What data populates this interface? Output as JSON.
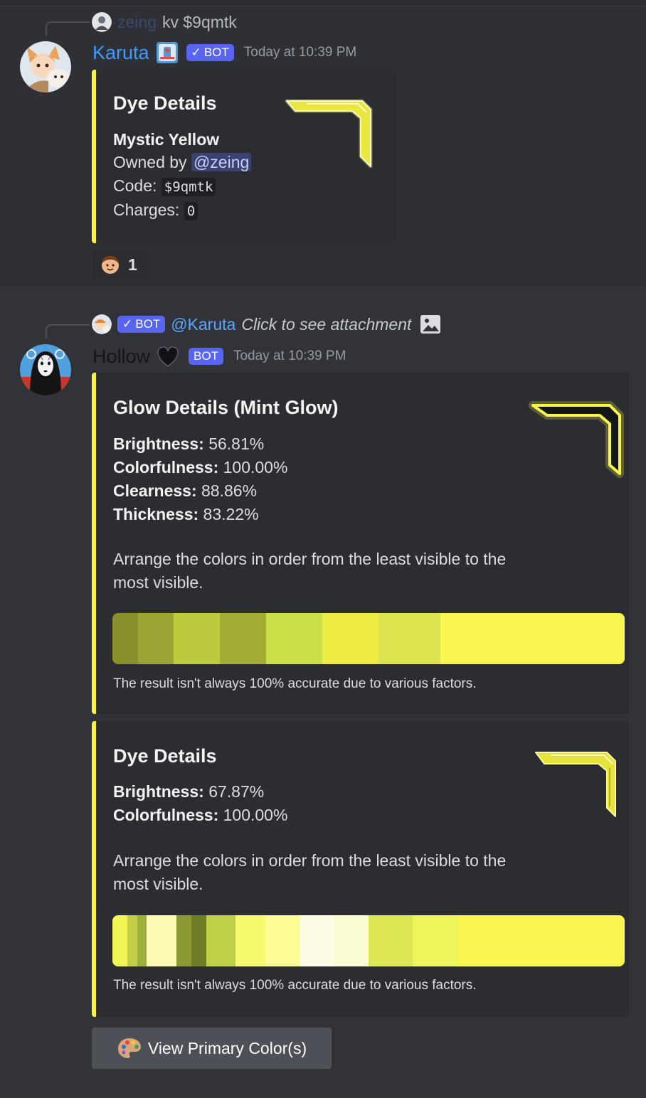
{
  "message1": {
    "reply": {
      "username": "zeing",
      "command": "kv $9qmtk"
    },
    "author": "Karuta",
    "bot_tag": "BOT",
    "timestamp": "Today at 10:39 PM",
    "embed": {
      "title": "Dye Details",
      "dye_name": "Mystic Yellow",
      "owned_label": "Owned by",
      "owner": "@zeing",
      "code_label": "Code:",
      "code": "$9qmtk",
      "charges_label": "Charges:",
      "charges": "0"
    },
    "reaction": {
      "count": "1",
      "emoji": "person-emoji"
    }
  },
  "message2": {
    "reply": {
      "bot_tag": "BOT",
      "mention": "@Karuta",
      "text": "Click to see attachment",
      "icon": "image-icon"
    },
    "author": "Hollow",
    "bot_tag": "BOT",
    "timestamp": "Today at 10:39 PM",
    "embed1": {
      "title": "Glow Details (Mint Glow)",
      "stats": [
        {
          "label": "Brightness:",
          "value": "56.81%"
        },
        {
          "label": "Colorfulness:",
          "value": "100.00%"
        },
        {
          "label": "Clearness:",
          "value": "88.86%"
        },
        {
          "label": "Thickness:",
          "value": "83.22%"
        }
      ],
      "instruction": "Arrange the colors in order from the least visible to the most visible.",
      "footer": "The result isn't always 100% accurate due to various factors.",
      "swatches": [
        "#8a902c",
        "#9da634",
        "#bccb3d",
        "#a3ad33",
        "#cadf48",
        "#eeec43",
        "#dde34c",
        "#f9f74f"
      ],
      "swatch_weights": [
        5,
        7,
        9,
        9,
        11,
        11,
        12,
        36
      ]
    },
    "embed2": {
      "title": "Dye Details",
      "stats": [
        {
          "label": "Brightness:",
          "value": "67.87%"
        },
        {
          "label": "Colorfulness:",
          "value": "100.00%"
        }
      ],
      "instruction": "Arrange the colors in order from the least visible to the most visible.",
      "footer": "The result isn't always 100% accurate due to various factors.",
      "swatches": [
        "#f2f556",
        "#c2d047",
        "#9fb03c",
        "#fbfbb4",
        "#8c9933",
        "#6f7c27",
        "#c0cf48",
        "#f8fa6e",
        "#fbfc93",
        "#fdfde5",
        "#fcfcd2",
        "#dde653",
        "#eef55a",
        "#f9f74f"
      ],
      "swatch_weights": [
        3,
        2,
        2,
        6,
        3,
        3,
        6,
        6,
        7,
        7,
        7,
        9,
        9,
        34
      ]
    },
    "button": {
      "label": "View Primary Color(s)",
      "icon": "palette-icon"
    }
  }
}
